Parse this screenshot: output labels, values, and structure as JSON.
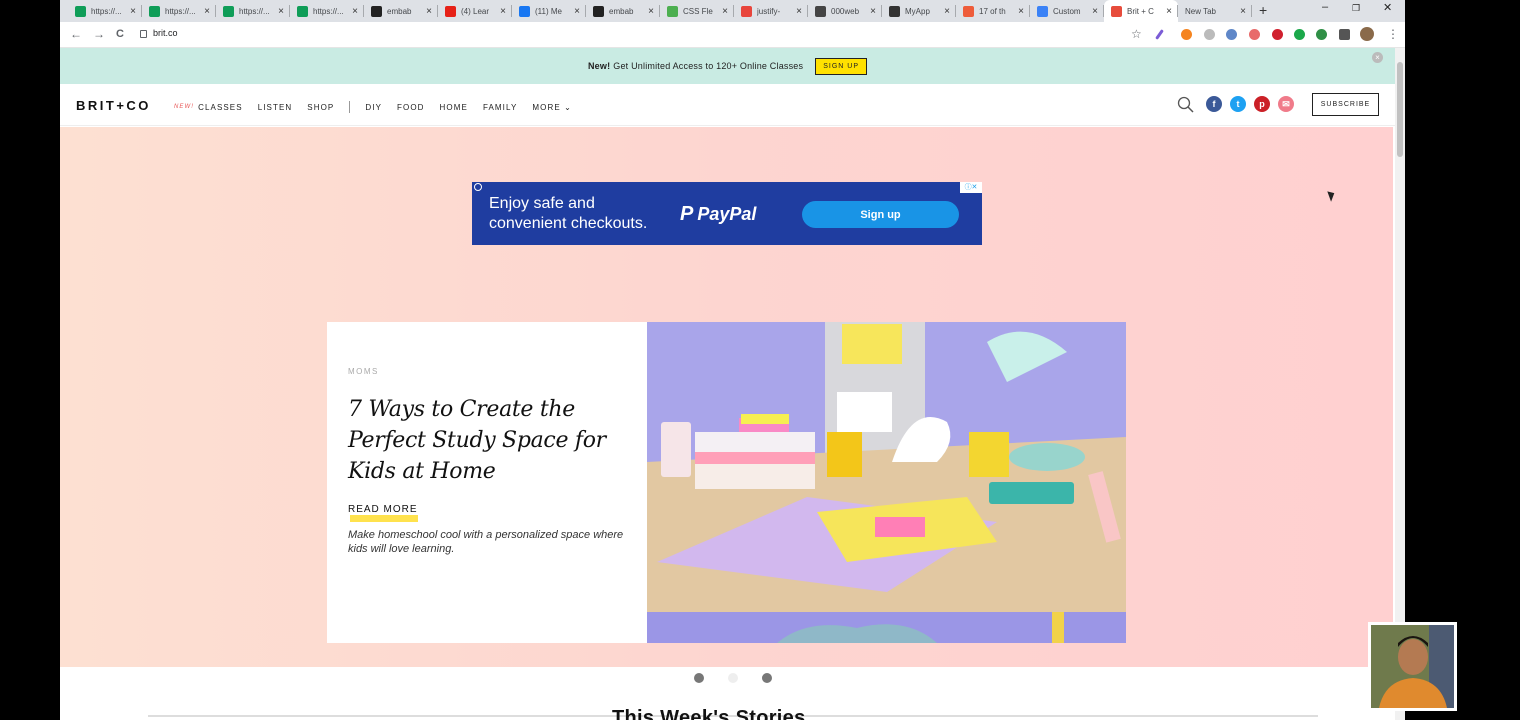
{
  "browser": {
    "tabs": [
      {
        "label": "https://...",
        "icon": "sheets-icon",
        "color": "#0f9d58"
      },
      {
        "label": "https://...",
        "icon": "sheets-icon",
        "color": "#0f9d58"
      },
      {
        "label": "https://...",
        "icon": "sheets-icon",
        "color": "#0f9d58"
      },
      {
        "label": "https://...",
        "icon": "sheets-icon",
        "color": "#0f9d58"
      },
      {
        "label": "embab",
        "icon": "github-icon",
        "color": "#222222"
      },
      {
        "label": "(4) Lear",
        "icon": "youtube-icon",
        "color": "#e62117"
      },
      {
        "label": "(11) Me",
        "icon": "facebook-icon",
        "color": "#1877f2"
      },
      {
        "label": "embab",
        "icon": "github-icon",
        "color": "#222222"
      },
      {
        "label": "CSS Fle",
        "icon": "css-icon",
        "color": "#4caf50"
      },
      {
        "label": "justify-",
        "icon": "justify-icon",
        "color": "#e8453c"
      },
      {
        "label": "000web",
        "icon": "globe-icon",
        "color": "#444444"
      },
      {
        "label": "MyApp",
        "icon": "angular-icon",
        "color": "#333333"
      },
      {
        "label": "17 of th",
        "icon": "page-icon",
        "color": "#ee5c3a"
      },
      {
        "label": "Custom",
        "icon": "lightning-icon",
        "color": "#3b82f6"
      },
      {
        "label": "Brit + C",
        "icon": "brit-icon",
        "color": "#e74c3c"
      },
      {
        "label": "New Tab",
        "icon": "none",
        "color": ""
      }
    ],
    "new_tab_symbol": "+",
    "minimize_symbol": "–",
    "restore_symbol": "❐",
    "close_symbol": "✕",
    "url": "brit.co",
    "back_symbol": "←",
    "forward_symbol": "→",
    "reload_symbol": "C",
    "star_symbol": "☆",
    "menu_symbol": "⋮"
  },
  "promo": {
    "bold": "New!",
    "text": "Get Unlimited Access to 120+ Online Classes",
    "button": "SIGN UP",
    "close": "×"
  },
  "nav": {
    "logo": "BRIT+CO",
    "new_badge": "NEW!",
    "items": [
      "CLASSES",
      "LISTEN",
      "SHOP"
    ],
    "items2": [
      "DIY",
      "FOOD",
      "HOME",
      "FAMILY"
    ],
    "more": "MORE ⌄",
    "subscribe": "SUBSCRIBE",
    "social_colors": {
      "facebook": "#3b5998",
      "twitter": "#1da1f2",
      "pinterest": "#cb2027",
      "email": "#f07b8a"
    }
  },
  "ad": {
    "text_line1": "Enjoy safe and",
    "text_line2": "convenient checkouts.",
    "brand": "PayPal",
    "button": "Sign up",
    "choices": "ⓘ✕"
  },
  "hero": {
    "kicker": "MOMS",
    "headline": "7 Ways to Create the Perfect Study Space for Kids at Home",
    "read_more": "READ MORE",
    "dek": "Make homeschool cool with a personalized space where kids will love learning."
  },
  "section": {
    "title": "This Week's Stories"
  }
}
